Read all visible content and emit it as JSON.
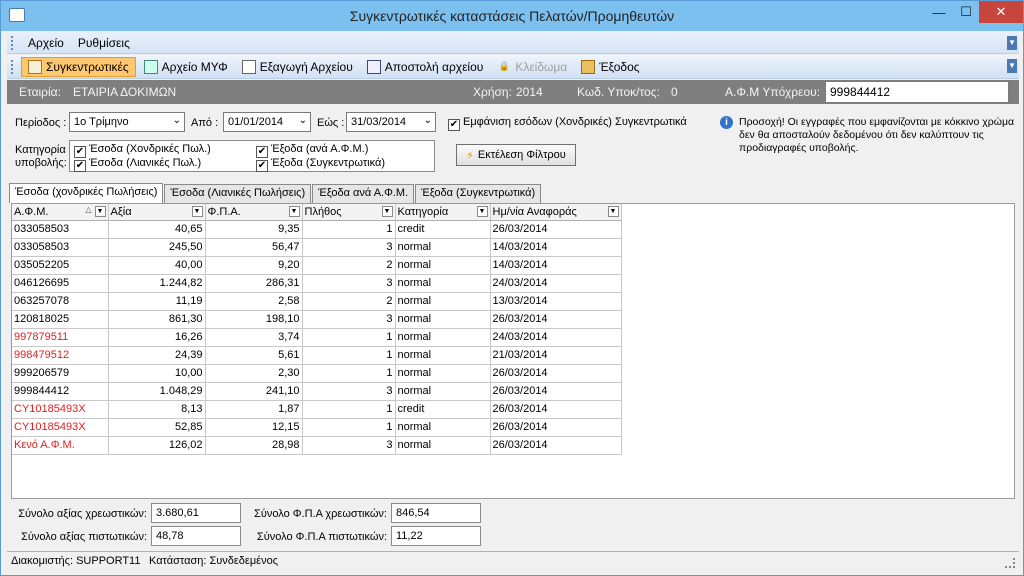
{
  "window": {
    "title": "Συγκεντρωτικές καταστάσεις Πελατών/Προμηθευτών",
    "min": "—",
    "max": "☐",
    "close": "✕"
  },
  "menu": {
    "items": [
      "Αρχείο",
      "Ρυθμίσεις"
    ]
  },
  "toolbar": {
    "items": [
      {
        "label": "Συγκεντρωτικές",
        "icon": "calendar-icon"
      },
      {
        "label": "Αρχείο ΜΥΦ",
        "icon": "grid-icon"
      },
      {
        "label": "Εξαγωγή Αρχείου",
        "icon": "export-icon"
      },
      {
        "label": "Αποστολή αρχείου",
        "icon": "send-icon"
      },
      {
        "label": "Κλείδωμα",
        "icon": "lock-icon"
      },
      {
        "label": "Έξοδος",
        "icon": "exit-icon"
      }
    ]
  },
  "info": {
    "company_label": "Εταιρία:",
    "company": "ΕΤΑΙΡΙΑ ΔΟΚΙΜΩΝ",
    "year_label": "Χρήση:",
    "year": "2014",
    "branch_label": "Κωδ. Υποκ/τος:",
    "branch": "0",
    "afm_label": "Α.Φ.Μ Υπόχρεου:",
    "afm": "999844412"
  },
  "filters": {
    "period_label": "Περίοδος :",
    "period": "1ο Τρίμηνο",
    "from_label": "Από :",
    "from": "01/01/2014",
    "to_label": "Εώς :",
    "to": "31/03/2014",
    "show_wholesale": "Εμφάνιση εσόδων (Χονδρικές) Συγκεντρωτικά",
    "category_label_1": "Κατηγορία",
    "category_label_2": "υποβολής:",
    "checks": [
      "Έσοδα (Χονδρικές Πωλ.)",
      "Έσοδα (Λιανικές Πωλ.)",
      "Έξοδα (ανά Α.Φ.Μ.)",
      "Έξοδα (Συγκεντρωτικά)"
    ],
    "execute": "Εκτέλεση Φίλτρου"
  },
  "note": "Προσοχή! Οι εγγραφές που εμφανίζονται με κόκκινο χρώμα δεν θα αποσταλούν δεδομένου ότι δεν καλύπτουν τις προδιαγραφές υποβολής.",
  "tabs": [
    "Έσοδα (χονδρικές Πωλήσεις)",
    "Έσοδα (Λιανικές Πωλήσεις)",
    "Έξοδα ανά Α.Φ.Μ.",
    "Έξοδα (Συγκεντρωτικά)"
  ],
  "table": {
    "columns": [
      "Α.Φ.Μ.",
      "Αξία",
      "Φ.Π.Α.",
      "Πλήθος",
      "Κατηγορία",
      "Ημ/νία Αναφοράς"
    ],
    "rows": [
      {
        "afm": "033058503",
        "value": "40,65",
        "vat": "9,35",
        "count": "1",
        "cat": "credit",
        "date": "26/03/2014",
        "red": false
      },
      {
        "afm": "033058503",
        "value": "245,50",
        "vat": "56,47",
        "count": "3",
        "cat": "normal",
        "date": "14/03/2014",
        "red": false
      },
      {
        "afm": "035052205",
        "value": "40,00",
        "vat": "9,20",
        "count": "2",
        "cat": "normal",
        "date": "14/03/2014",
        "red": false
      },
      {
        "afm": "046126695",
        "value": "1.244,82",
        "vat": "286,31",
        "count": "3",
        "cat": "normal",
        "date": "24/03/2014",
        "red": false
      },
      {
        "afm": "063257078",
        "value": "11,19",
        "vat": "2,58",
        "count": "2",
        "cat": "normal",
        "date": "13/03/2014",
        "red": false
      },
      {
        "afm": "120818025",
        "value": "861,30",
        "vat": "198,10",
        "count": "3",
        "cat": "normal",
        "date": "26/03/2014",
        "red": false
      },
      {
        "afm": "997879511",
        "value": "16,26",
        "vat": "3,74",
        "count": "1",
        "cat": "normal",
        "date": "24/03/2014",
        "red": true
      },
      {
        "afm": "998479512",
        "value": "24,39",
        "vat": "5,61",
        "count": "1",
        "cat": "normal",
        "date": "21/03/2014",
        "red": true
      },
      {
        "afm": "999206579",
        "value": "10,00",
        "vat": "2,30",
        "count": "1",
        "cat": "normal",
        "date": "26/03/2014",
        "red": false
      },
      {
        "afm": "999844412",
        "value": "1.048,29",
        "vat": "241,10",
        "count": "3",
        "cat": "normal",
        "date": "26/03/2014",
        "red": false
      },
      {
        "afm": "CY10185493X",
        "value": "8,13",
        "vat": "1,87",
        "count": "1",
        "cat": "credit",
        "date": "26/03/2014",
        "red": true
      },
      {
        "afm": "CY10185493X",
        "value": "52,85",
        "vat": "12,15",
        "count": "1",
        "cat": "normal",
        "date": "26/03/2014",
        "red": true
      },
      {
        "afm": "Κενό Α.Φ.Μ.",
        "value": "126,02",
        "vat": "28,98",
        "count": "3",
        "cat": "normal",
        "date": "26/03/2014",
        "red": true
      }
    ]
  },
  "totals": {
    "debit_value_label": "Σύνολο αξίας χρεωστικών:",
    "debit_value": "3.680,61",
    "credit_value_label": "Σύνολο αξίας πιστωτικών:",
    "credit_value": "48,78",
    "debit_vat_label": "Σύνολο Φ.Π.Α χρεωστικών:",
    "debit_vat": "846,54",
    "credit_vat_label": "Σύνολο Φ.Π.Α πιστωτικών:",
    "credit_vat": "11,22"
  },
  "status": {
    "server": "Διακομιστής: SUPPORT11",
    "state": "Κατάσταση: Συνδεδεμένος"
  },
  "colors": {
    "accent": "#7cc0f0",
    "active_tool": "#ffc870",
    "invalid_row": "#e02020",
    "info_bar": "#7f7f7f"
  }
}
